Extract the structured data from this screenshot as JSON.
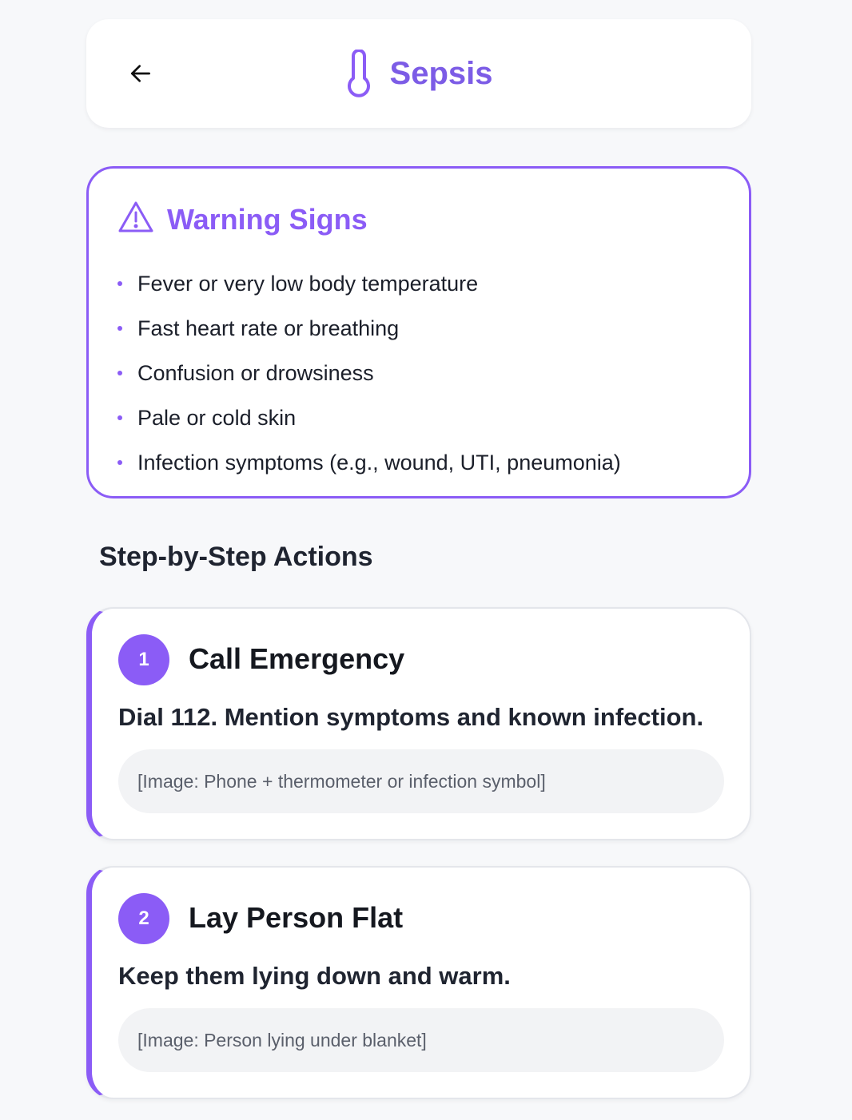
{
  "colors": {
    "accent": "#8b5cf6",
    "background": "#f7f8fa",
    "card": "#ffffff",
    "placeholder_bg": "#f2f3f5"
  },
  "header": {
    "back_icon": "arrow-left-icon",
    "title_icon": "thermometer-icon",
    "title": "Sepsis"
  },
  "warning": {
    "icon": "warning-triangle-icon",
    "title": "Warning Signs",
    "items": [
      "Fever or very low body temperature",
      "Fast heart rate or breathing",
      "Confusion or drowsiness",
      "Pale or cold skin",
      "Infection symptoms (e.g., wound, UTI, pneumonia)"
    ]
  },
  "actions": {
    "section_title": "Step-by-Step Actions",
    "steps": [
      {
        "number": "1",
        "title": "Call Emergency",
        "description": "Dial 112. Mention symptoms and known infection.",
        "image_placeholder": "[Image: Phone + thermometer or infection symbol]"
      },
      {
        "number": "2",
        "title": "Lay Person Flat",
        "description": "Keep them lying down and warm.",
        "image_placeholder": "[Image: Person lying under blanket]"
      }
    ]
  }
}
